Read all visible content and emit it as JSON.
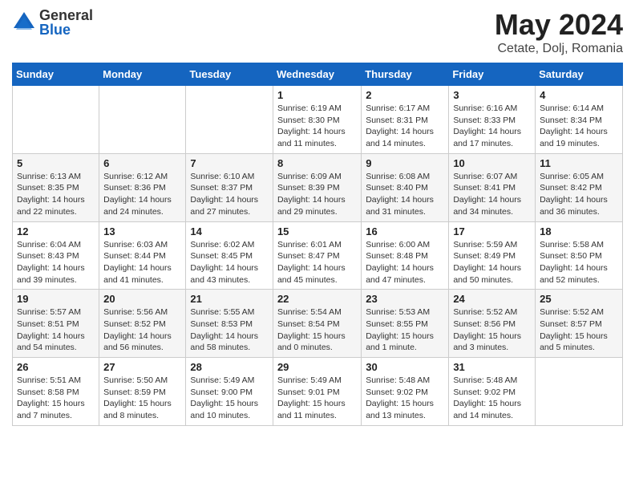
{
  "logo": {
    "general": "General",
    "blue": "Blue"
  },
  "title": {
    "month": "May 2024",
    "location": "Cetate, Dolj, Romania"
  },
  "weekdays": [
    "Sunday",
    "Monday",
    "Tuesday",
    "Wednesday",
    "Thursday",
    "Friday",
    "Saturday"
  ],
  "weeks": [
    [
      {
        "day": "",
        "info": ""
      },
      {
        "day": "",
        "info": ""
      },
      {
        "day": "",
        "info": ""
      },
      {
        "day": "1",
        "info": "Sunrise: 6:19 AM\nSunset: 8:30 PM\nDaylight: 14 hours\nand 11 minutes."
      },
      {
        "day": "2",
        "info": "Sunrise: 6:17 AM\nSunset: 8:31 PM\nDaylight: 14 hours\nand 14 minutes."
      },
      {
        "day": "3",
        "info": "Sunrise: 6:16 AM\nSunset: 8:33 PM\nDaylight: 14 hours\nand 17 minutes."
      },
      {
        "day": "4",
        "info": "Sunrise: 6:14 AM\nSunset: 8:34 PM\nDaylight: 14 hours\nand 19 minutes."
      }
    ],
    [
      {
        "day": "5",
        "info": "Sunrise: 6:13 AM\nSunset: 8:35 PM\nDaylight: 14 hours\nand 22 minutes."
      },
      {
        "day": "6",
        "info": "Sunrise: 6:12 AM\nSunset: 8:36 PM\nDaylight: 14 hours\nand 24 minutes."
      },
      {
        "day": "7",
        "info": "Sunrise: 6:10 AM\nSunset: 8:37 PM\nDaylight: 14 hours\nand 27 minutes."
      },
      {
        "day": "8",
        "info": "Sunrise: 6:09 AM\nSunset: 8:39 PM\nDaylight: 14 hours\nand 29 minutes."
      },
      {
        "day": "9",
        "info": "Sunrise: 6:08 AM\nSunset: 8:40 PM\nDaylight: 14 hours\nand 31 minutes."
      },
      {
        "day": "10",
        "info": "Sunrise: 6:07 AM\nSunset: 8:41 PM\nDaylight: 14 hours\nand 34 minutes."
      },
      {
        "day": "11",
        "info": "Sunrise: 6:05 AM\nSunset: 8:42 PM\nDaylight: 14 hours\nand 36 minutes."
      }
    ],
    [
      {
        "day": "12",
        "info": "Sunrise: 6:04 AM\nSunset: 8:43 PM\nDaylight: 14 hours\nand 39 minutes."
      },
      {
        "day": "13",
        "info": "Sunrise: 6:03 AM\nSunset: 8:44 PM\nDaylight: 14 hours\nand 41 minutes."
      },
      {
        "day": "14",
        "info": "Sunrise: 6:02 AM\nSunset: 8:45 PM\nDaylight: 14 hours\nand 43 minutes."
      },
      {
        "day": "15",
        "info": "Sunrise: 6:01 AM\nSunset: 8:47 PM\nDaylight: 14 hours\nand 45 minutes."
      },
      {
        "day": "16",
        "info": "Sunrise: 6:00 AM\nSunset: 8:48 PM\nDaylight: 14 hours\nand 47 minutes."
      },
      {
        "day": "17",
        "info": "Sunrise: 5:59 AM\nSunset: 8:49 PM\nDaylight: 14 hours\nand 50 minutes."
      },
      {
        "day": "18",
        "info": "Sunrise: 5:58 AM\nSunset: 8:50 PM\nDaylight: 14 hours\nand 52 minutes."
      }
    ],
    [
      {
        "day": "19",
        "info": "Sunrise: 5:57 AM\nSunset: 8:51 PM\nDaylight: 14 hours\nand 54 minutes."
      },
      {
        "day": "20",
        "info": "Sunrise: 5:56 AM\nSunset: 8:52 PM\nDaylight: 14 hours\nand 56 minutes."
      },
      {
        "day": "21",
        "info": "Sunrise: 5:55 AM\nSunset: 8:53 PM\nDaylight: 14 hours\nand 58 minutes."
      },
      {
        "day": "22",
        "info": "Sunrise: 5:54 AM\nSunset: 8:54 PM\nDaylight: 15 hours\nand 0 minutes."
      },
      {
        "day": "23",
        "info": "Sunrise: 5:53 AM\nSunset: 8:55 PM\nDaylight: 15 hours\nand 1 minute."
      },
      {
        "day": "24",
        "info": "Sunrise: 5:52 AM\nSunset: 8:56 PM\nDaylight: 15 hours\nand 3 minutes."
      },
      {
        "day": "25",
        "info": "Sunrise: 5:52 AM\nSunset: 8:57 PM\nDaylight: 15 hours\nand 5 minutes."
      }
    ],
    [
      {
        "day": "26",
        "info": "Sunrise: 5:51 AM\nSunset: 8:58 PM\nDaylight: 15 hours\nand 7 minutes."
      },
      {
        "day": "27",
        "info": "Sunrise: 5:50 AM\nSunset: 8:59 PM\nDaylight: 15 hours\nand 8 minutes."
      },
      {
        "day": "28",
        "info": "Sunrise: 5:49 AM\nSunset: 9:00 PM\nDaylight: 15 hours\nand 10 minutes."
      },
      {
        "day": "29",
        "info": "Sunrise: 5:49 AM\nSunset: 9:01 PM\nDaylight: 15 hours\nand 11 minutes."
      },
      {
        "day": "30",
        "info": "Sunrise: 5:48 AM\nSunset: 9:02 PM\nDaylight: 15 hours\nand 13 minutes."
      },
      {
        "day": "31",
        "info": "Sunrise: 5:48 AM\nSunset: 9:02 PM\nDaylight: 15 hours\nand 14 minutes."
      },
      {
        "day": "",
        "info": ""
      }
    ]
  ]
}
